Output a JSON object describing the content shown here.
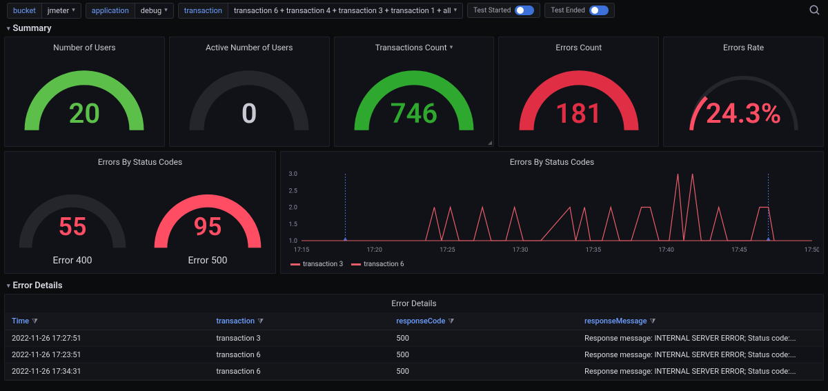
{
  "toolbar": {
    "vars": [
      {
        "label": "bucket",
        "value": "jmeter"
      },
      {
        "label": "application",
        "value": "debug"
      },
      {
        "label": "transaction",
        "value": "transaction 6 + transaction 4 + transaction 3 + transaction 1 + all"
      }
    ],
    "toggles": [
      {
        "label": "Test Started",
        "on": true
      },
      {
        "label": "Test Ended",
        "on": true
      }
    ]
  },
  "sections": {
    "summary": "Summary",
    "error_details": "Error Details"
  },
  "gauges": {
    "users": {
      "title": "Number of Users",
      "value": "20",
      "color": "#5cbf4a"
    },
    "active_users": {
      "title": "Active Number of Users",
      "value": "0",
      "color": "#2a2d34"
    },
    "transactions": {
      "title": "Transactions Count",
      "value": "746",
      "color": "#2fa82f"
    },
    "errors": {
      "title": "Errors Count",
      "value": "181",
      "color": "#e02f44"
    },
    "error_rate": {
      "title": "Errors Rate",
      "value": "24.3%",
      "color": "#ff4d63"
    },
    "err400": {
      "title": "Error 400",
      "value": "55",
      "color": "#2a2d34",
      "value_color": "#ff4d63"
    },
    "err500": {
      "title": "Error 500",
      "value": "95",
      "color": "#ff4d63",
      "value_color": "#ff4d63"
    }
  },
  "status_panel_title": "Errors By Status Codes",
  "chart_panel_title": "Errors By Status Codes",
  "chart_legend": [
    "transaction 3",
    "transaction 6"
  ],
  "chart_data": {
    "type": "line",
    "xlabel": "",
    "ylabel": "",
    "ylim": [
      1.0,
      3.0
    ],
    "y_ticks": [
      1.0,
      1.5,
      2.0,
      2.5,
      3.0
    ],
    "x_ticks": [
      "17:15",
      "17:20",
      "17:25",
      "17:30",
      "17:35",
      "17:40",
      "17:45",
      "17:50"
    ],
    "x_range": [
      "17:15",
      "17:50"
    ],
    "markers": [
      "17:18",
      "17:47"
    ],
    "series": [
      {
        "name": "transaction 3",
        "color": "#e85d6b",
        "points": [
          [
            "17:23.5",
            1
          ],
          [
            "17:24.1",
            2
          ],
          [
            "17:24.6",
            1
          ],
          [
            "17:25.2",
            2
          ],
          [
            "17:25.8",
            1
          ],
          [
            "17:26.8",
            1
          ],
          [
            "17:27.4",
            2
          ],
          [
            "17:28.0",
            1
          ],
          [
            "17:29.0",
            1
          ],
          [
            "17:29.6",
            2
          ],
          [
            "17:30.2",
            1
          ],
          [
            "17:31.4",
            1
          ],
          [
            "17:33.4",
            2
          ],
          [
            "17:33.8",
            1
          ],
          [
            "17:34.4",
            2
          ],
          [
            "17:34.8",
            1
          ],
          [
            "17:35.6",
            1
          ],
          [
            "17:36.2",
            2
          ],
          [
            "17:36.8",
            1
          ],
          [
            "17:37.6",
            1
          ],
          [
            "17:38.3",
            2
          ],
          [
            "17:38.9",
            2
          ],
          [
            "17:39.5",
            1
          ],
          [
            "17:40.2",
            1
          ],
          [
            "17:40.8",
            3
          ],
          [
            "17:41.2",
            1
          ],
          [
            "17:41.8",
            3
          ],
          [
            "17:42.4",
            1
          ],
          [
            "17:43.0",
            1
          ],
          [
            "17:43.6",
            2
          ],
          [
            "17:44.2",
            1
          ],
          [
            "17:45.8",
            1
          ],
          [
            "17:46.4",
            2
          ],
          [
            "17:47.0",
            2
          ],
          [
            "17:47.4",
            1
          ]
        ]
      },
      {
        "name": "transaction 6",
        "color": "#e85d6b",
        "points": [
          [
            "17:18",
            1
          ],
          [
            "17:47",
            1
          ]
        ]
      }
    ]
  },
  "table": {
    "title": "Error Details",
    "columns": [
      "Time",
      "transaction",
      "responseCode",
      "responseMessage"
    ],
    "rows": [
      {
        "time": "2022-11-26 17:27:51",
        "transaction": "transaction 3",
        "responseCode": "500",
        "responseMessage": "Response message: INTERNAL SERVER ERROR; Status code:..."
      },
      {
        "time": "2022-11-26 17:23:51",
        "transaction": "transaction 6",
        "responseCode": "500",
        "responseMessage": "Response message: INTERNAL SERVER ERROR; Status code:..."
      },
      {
        "time": "2022-11-26 17:34:31",
        "transaction": "transaction 6",
        "responseCode": "500",
        "responseMessage": "Response message: INTERNAL SERVER ERROR; Status code:..."
      }
    ]
  }
}
